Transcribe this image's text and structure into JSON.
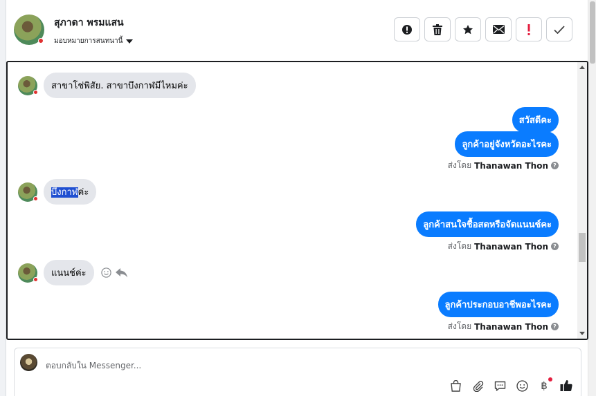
{
  "header": {
    "contact_name": "สุภาดา พรมแสน",
    "assign_label": "มอบหมายการสนทนานี้"
  },
  "messages": [
    {
      "direction": "in",
      "text": "สาขาโช่พิสัย. สาขาบึงกาฬมีไหมค่ะ"
    },
    {
      "direction": "out",
      "text": "สวัสดีคะ"
    },
    {
      "direction": "out",
      "text": "ลูกค้าอยู่จังหวัดอะไรคะ"
    },
    {
      "direction": "in",
      "text_highlight": "บึงกาฬ",
      "text_rest": "ค่ะ"
    },
    {
      "direction": "out",
      "text": "ลูกค้าสนใจชื้อสดหรือจัดแนนช์คะ"
    },
    {
      "direction": "in",
      "text": "แนนช์ค่ะ"
    },
    {
      "direction": "out",
      "text": "ลูกค้าประกอบอาชีพอะไรคะ"
    }
  ],
  "sent_by": {
    "prefix": "ส่งโดย",
    "agent": "Thanawan Thon",
    "info": "?"
  },
  "composer": {
    "placeholder": "ตอบกลับใน Messenger...",
    "currency_symbol": "฿"
  },
  "colors": {
    "outgoing_bubble": "#0a7cff",
    "incoming_bubble": "#e4e6eb",
    "important_red": "#e41e3f"
  },
  "icons": [
    "alert-icon",
    "trash-icon",
    "star-icon",
    "mail-icon",
    "important-icon",
    "checkmark-icon",
    "emoji-icon",
    "reply-icon",
    "shopping-bag-icon",
    "paperclip-icon",
    "saved-replies-icon",
    "emoji-icon",
    "baht-icon",
    "thumbs-up-icon"
  ]
}
